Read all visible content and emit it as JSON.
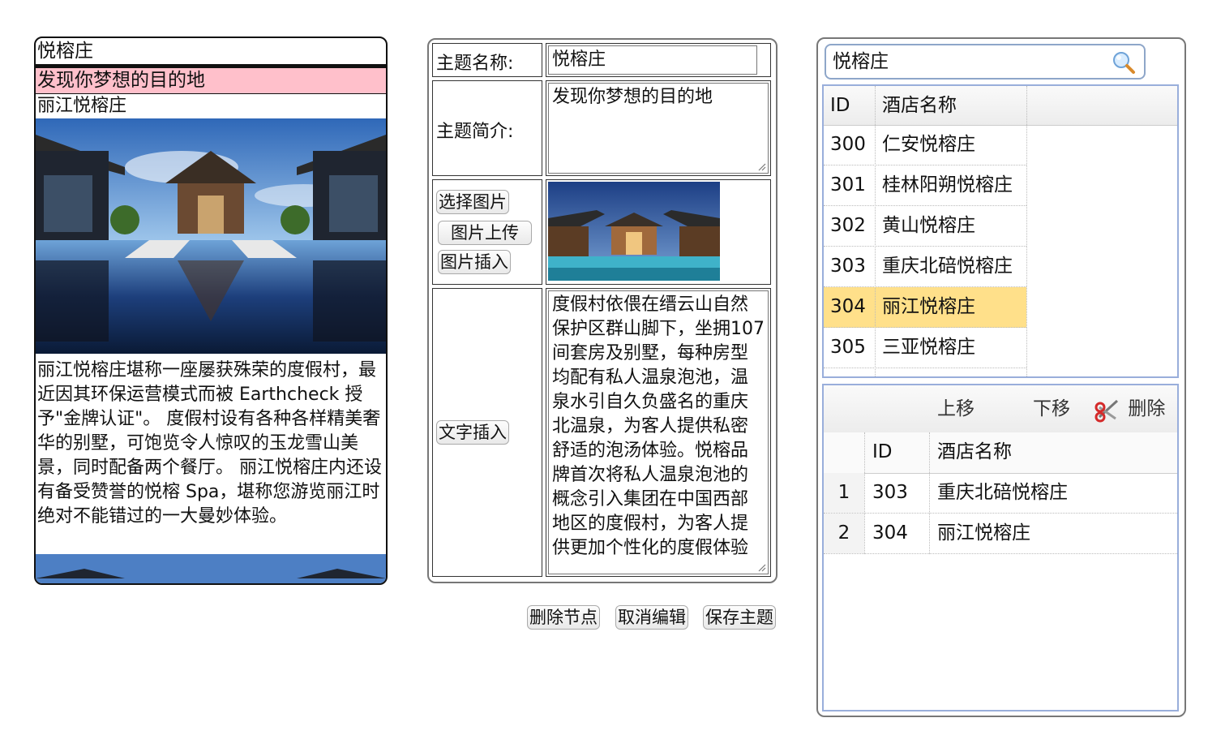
{
  "preview": {
    "title": "悦榕庄",
    "subtitle": "发现你梦想的目的地",
    "hotel_name": "丽江悦榕庄",
    "description": "丽江悦榕庄堪称一座屡获殊荣的度假村，最近因其环保运营模式而被 Earthcheck 授予\"金牌认证\"。 度假村设有各种各样精美奢华的别墅，可饱览令人惊叹的玉龙雪山美景，同时配备两个餐厅。 丽江悦榕庄内还设有备受赞誉的悦榕 Spa，堪称您游览丽江时绝对不能错过的一大曼妙体验。"
  },
  "form": {
    "theme_name_label": "主题名称:",
    "theme_name_value": "悦榕庄",
    "theme_intro_label": "主题简介:",
    "theme_intro_value": "发现你梦想的目的地",
    "select_image_btn": "选择图片",
    "upload_image_btn": "图片上传",
    "insert_image_btn": "图片插入",
    "insert_text_btn": "文字插入",
    "text_content": "度假村依偎在缙云山自然保护区群山脚下，坐拥107 间套房及别墅，每种房型均配有私人温泉泡池，温泉水引自久负盛名的重庆北温泉，为客人提供私密舒适的泡汤体验。悦榕品牌首次将私人温泉泡池的概念引入集团在中国西部地区的度假村，为客人提供更加个性化的度假体验"
  },
  "actions": {
    "delete_node": "删除节点",
    "cancel_edit": "取消编辑",
    "save_theme": "保存主题"
  },
  "search": {
    "value": "悦榕庄",
    "icon": "search-icon"
  },
  "hotel_grid": {
    "headers": [
      "ID",
      "酒店名称"
    ],
    "rows": [
      {
        "id": "300",
        "name": "仁安悦榕庄"
      },
      {
        "id": "301",
        "name": "桂林阳朔悦榕庄"
      },
      {
        "id": "302",
        "name": "黄山悦榕庄"
      },
      {
        "id": "303",
        "name": "重庆北碚悦榕庄"
      },
      {
        "id": "304",
        "name": "丽江悦榕庄"
      },
      {
        "id": "305",
        "name": "三亚悦榕庄"
      }
    ],
    "selected_id": "304",
    "selected_color": "#ffe08a"
  },
  "selected_grid": {
    "toolbar": {
      "move_up": "上移",
      "move_down": "下移",
      "delete": "删除",
      "delete_icon": "scissors-icon"
    },
    "headers": [
      "ID",
      "酒店名称"
    ],
    "rows": [
      {
        "num": "1",
        "id": "303",
        "name": "重庆北碚悦榕庄"
      },
      {
        "num": "2",
        "id": "304",
        "name": "丽江悦榕庄"
      }
    ]
  }
}
